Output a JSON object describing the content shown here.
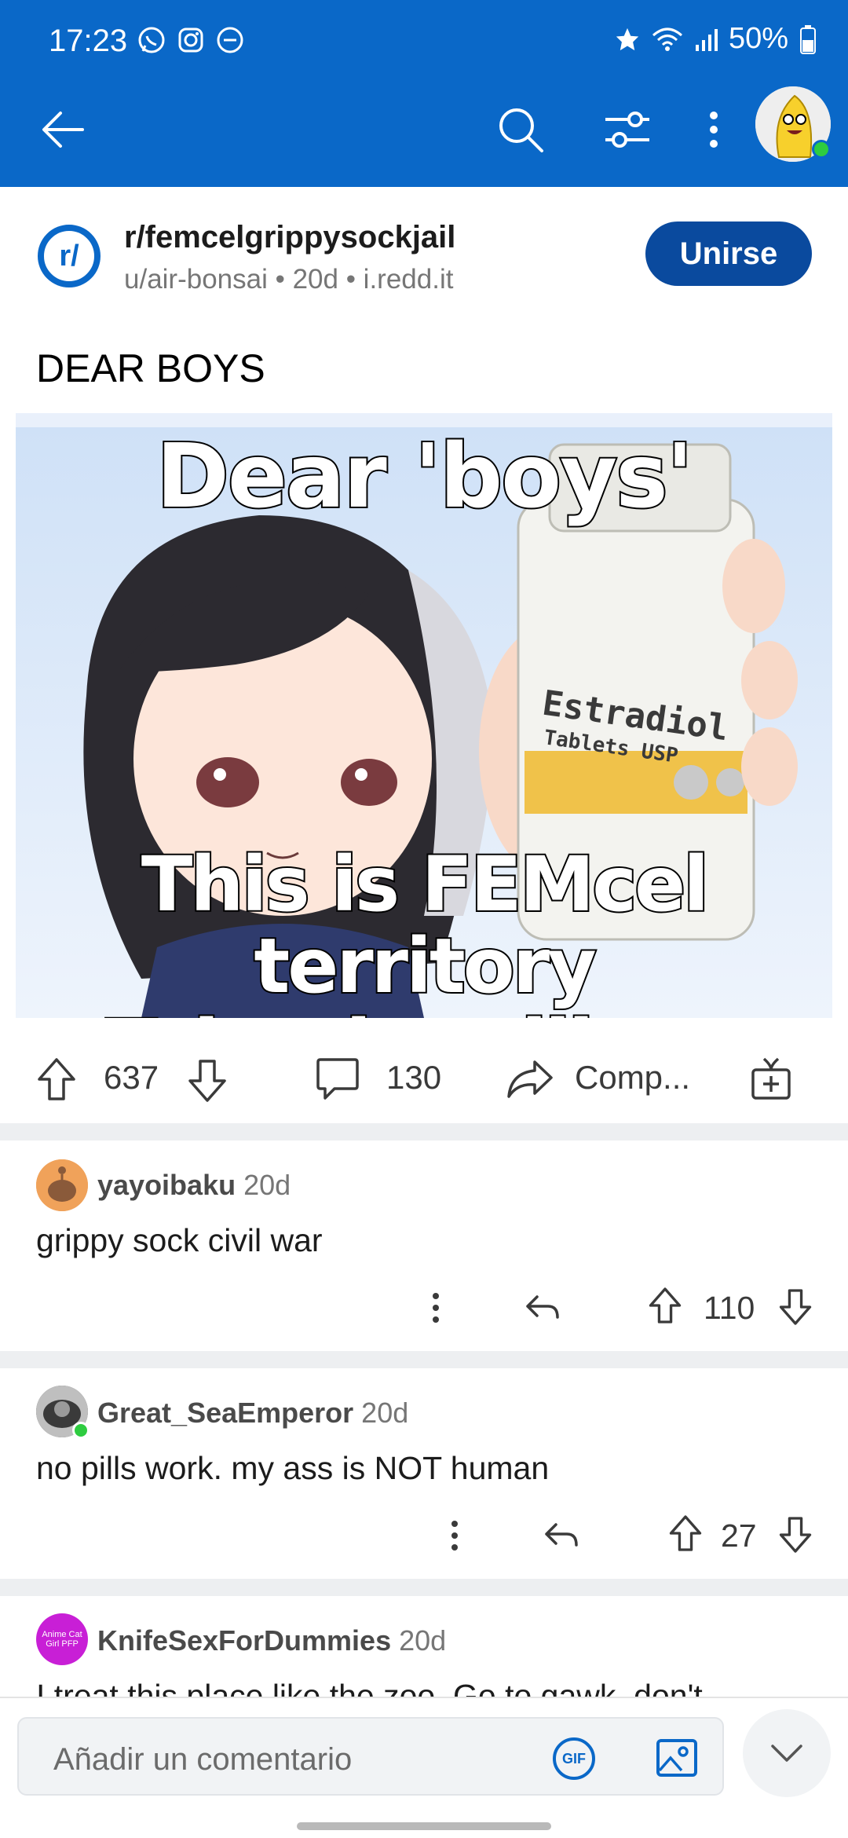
{
  "status_bar": {
    "time": "17:23",
    "battery": "50%"
  },
  "app_bar": {
    "icons": [
      "back-arrow-icon",
      "search-icon",
      "filter-icon",
      "more-vertical-icon",
      "avatar"
    ]
  },
  "post": {
    "subreddit": "r/femcelgrippysockjail",
    "meta": "u/air-bonsai • 20d • i.redd.it",
    "join_label": "Unirse",
    "title": "DEAR BOYS",
    "image": {
      "top_caption": "Dear 'boys'",
      "bottom_caption_line1": "This is FEMcel territory",
      "bottom_caption_line2": "Take the pills or leave",
      "bottle_label": "Estradiol",
      "bottle_sublabel": "Tablets USP"
    },
    "votes": "637",
    "comments": "130",
    "share_label": "Comp..."
  },
  "comments": [
    {
      "user": "yayoibaku",
      "time": "20d",
      "body": "grippy sock civil war",
      "votes": "110"
    },
    {
      "user": "Great_SeaEmperor",
      "time": "20d",
      "body": "no pills work. my ass is NOT human",
      "votes": "27"
    },
    {
      "user": "KnifeSexForDummies",
      "time": "20d",
      "avatar_text": "Anime Cat Girl PFP",
      "body": "I treat this place like the zoo. Go to gawk, don't"
    }
  ],
  "composer": {
    "placeholder": "Añadir un comentario",
    "gif_label": "GIF"
  },
  "colors": {
    "brand_blue": "#0a68c8",
    "join_button": "#0a4a9e"
  }
}
